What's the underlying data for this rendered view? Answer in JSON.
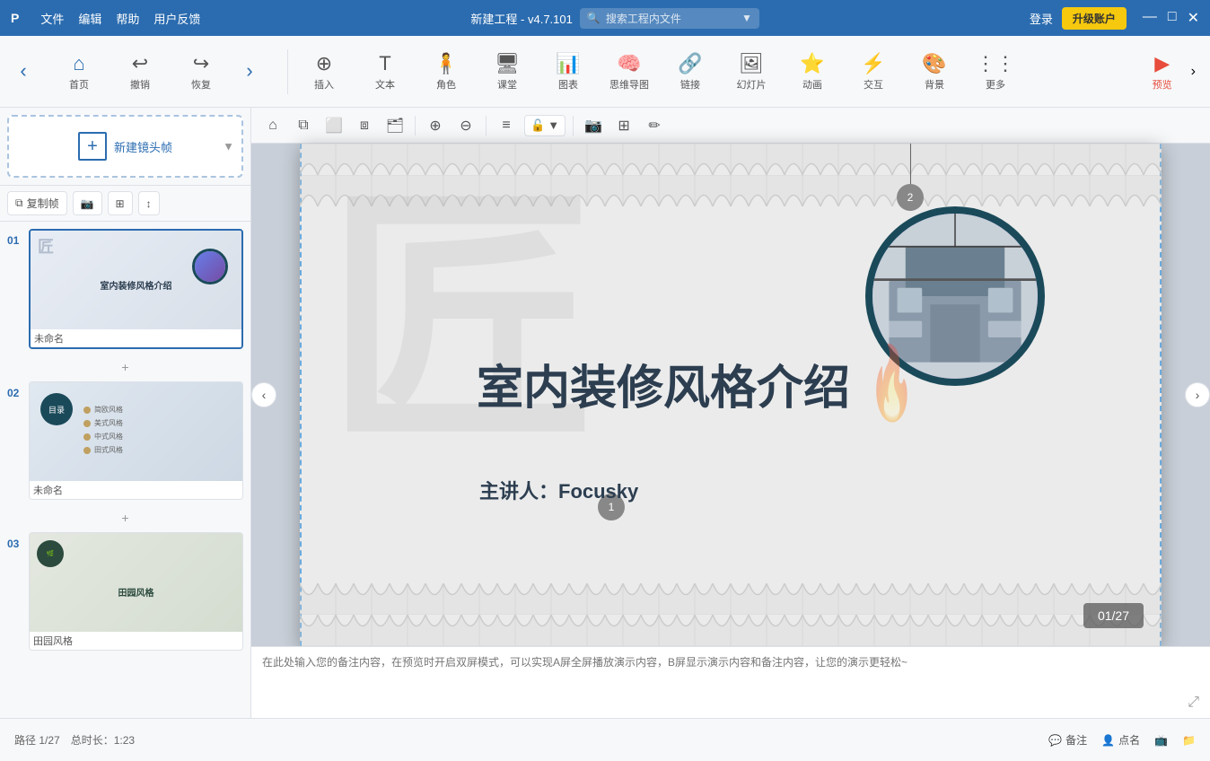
{
  "titlebar": {
    "logo": "P",
    "menus": [
      "文件",
      "编辑",
      "帮助",
      "用户反馈"
    ],
    "title": "新建工程 - v4.7.101",
    "search_placeholder": "搜索工程内文件",
    "login": "登录",
    "upgrade": "升级账户"
  },
  "toolbar": {
    "home": "首页",
    "undo": "撤销",
    "redo": "恢复",
    "insert": "插入",
    "text": "文本",
    "character": "角色",
    "classroom": "课堂",
    "chart": "图表",
    "mindmap": "思维导图",
    "link": "链接",
    "slideshow": "幻灯片",
    "animation": "动画",
    "interact": "交互",
    "background": "背景",
    "more": "更多",
    "preview": "预览"
  },
  "sidebar": {
    "new_frame": "新建镜头帧",
    "copy_frame": "复制帧",
    "actions": [
      "复制帧",
      "📷",
      "⊞",
      "↕"
    ],
    "slides": [
      {
        "num": "01",
        "name": "未命名",
        "active": true
      },
      {
        "num": "02",
        "name": "未命名",
        "active": false
      },
      {
        "num": "03",
        "name": "田园风格",
        "active": false
      }
    ]
  },
  "canvas": {
    "slide_title": "室内装修风格介绍",
    "slide_subtitle": "主讲人：Focusky",
    "slide_char": "匠",
    "page_indicator": "01/27",
    "badge1": "1",
    "badge2": "2",
    "notes_placeholder": "在此处输入您的备注内容，在预览时开启双屏模式，可以实现A屏全屏播放演示内容，B屏显示演示内容和备注内容，让您的演示更轻松~"
  },
  "bottombar": {
    "path": "路径 1/27",
    "duration": "总时长：1:23",
    "notes": "备注",
    "pointname": "点名",
    "icon1": "💬",
    "icon2": "👤",
    "icon3": "📺",
    "icon4": "📁"
  }
}
